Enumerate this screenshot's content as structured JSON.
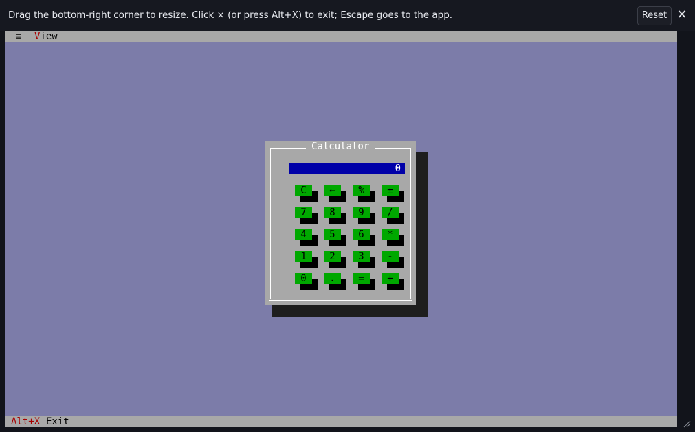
{
  "overlay": {
    "hint": "Drag the bottom-right corner to resize. Click × (or press Alt+X) to exit; Escape goes to the app.",
    "reset_label": "Reset",
    "close_label": "✕"
  },
  "menubar": {
    "menu_icon": "≡",
    "view": {
      "hotkey": "V",
      "rest": "iew"
    }
  },
  "statusbar": {
    "key": "Alt+X",
    "label": "Exit"
  },
  "calculator": {
    "title": "Calculator",
    "display": "0",
    "buttons": [
      "C",
      "←",
      "%",
      "±",
      "7",
      "8",
      "9",
      "/",
      "4",
      "5",
      "6",
      "*",
      "1",
      "2",
      "3",
      "-",
      "0",
      ".",
      "=",
      "+"
    ]
  },
  "colors": {
    "desktop": "#a9a9c9",
    "window_gray": "#a8a8a8",
    "display_blue": "#0000a8",
    "button_green": "#00a800",
    "hotkey_red": "#a80000"
  }
}
